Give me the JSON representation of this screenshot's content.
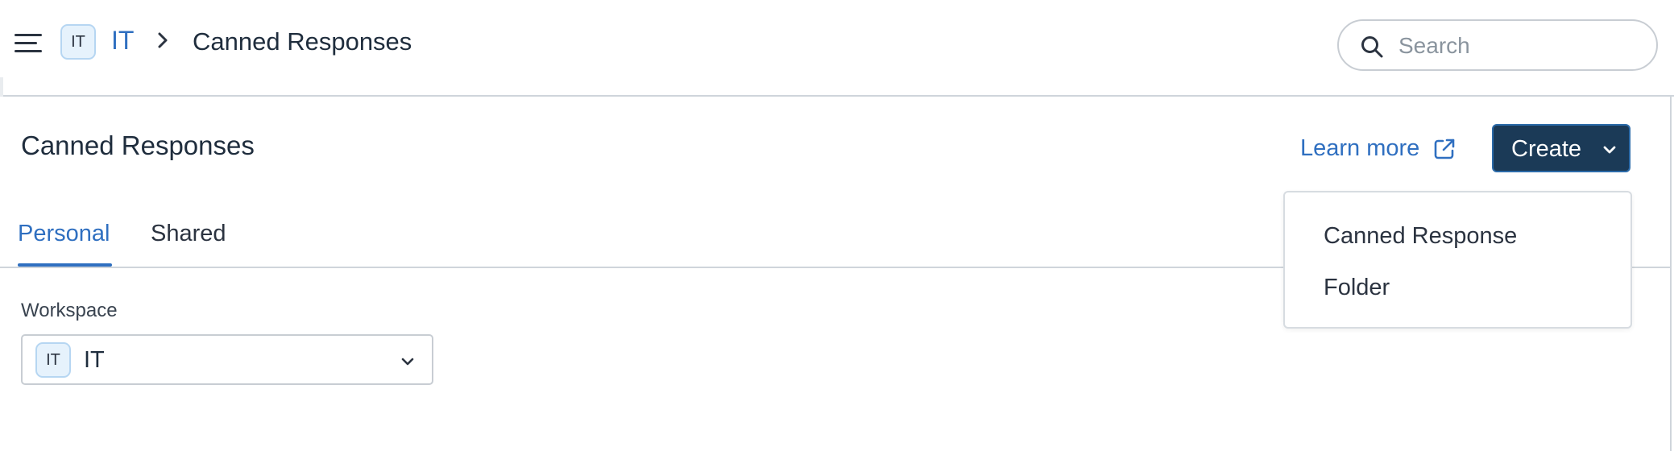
{
  "header": {
    "workspace_badge": "IT",
    "breadcrumb_workspace": "IT",
    "breadcrumb_page": "Canned Responses",
    "search_placeholder": "Search"
  },
  "page": {
    "title": "Canned Responses",
    "learn_more": "Learn more",
    "create_label": "Create"
  },
  "tabs": [
    {
      "label": "Personal",
      "active": true
    },
    {
      "label": "Shared",
      "active": false
    }
  ],
  "workspace_field": {
    "label": "Workspace",
    "badge": "IT",
    "value": "IT"
  },
  "create_menu": {
    "items": [
      "Canned Response",
      "Folder"
    ]
  },
  "colors": {
    "accent": "#2f6fc0",
    "create_button_bg": "#1b3a57",
    "badge_bg": "#e6f2fc",
    "badge_border": "#b6d6f2",
    "divider": "#cfd5db"
  },
  "icons": [
    "menu-icon",
    "chevron-right-icon",
    "search-icon",
    "external-link-icon",
    "chevron-down-icon"
  ]
}
